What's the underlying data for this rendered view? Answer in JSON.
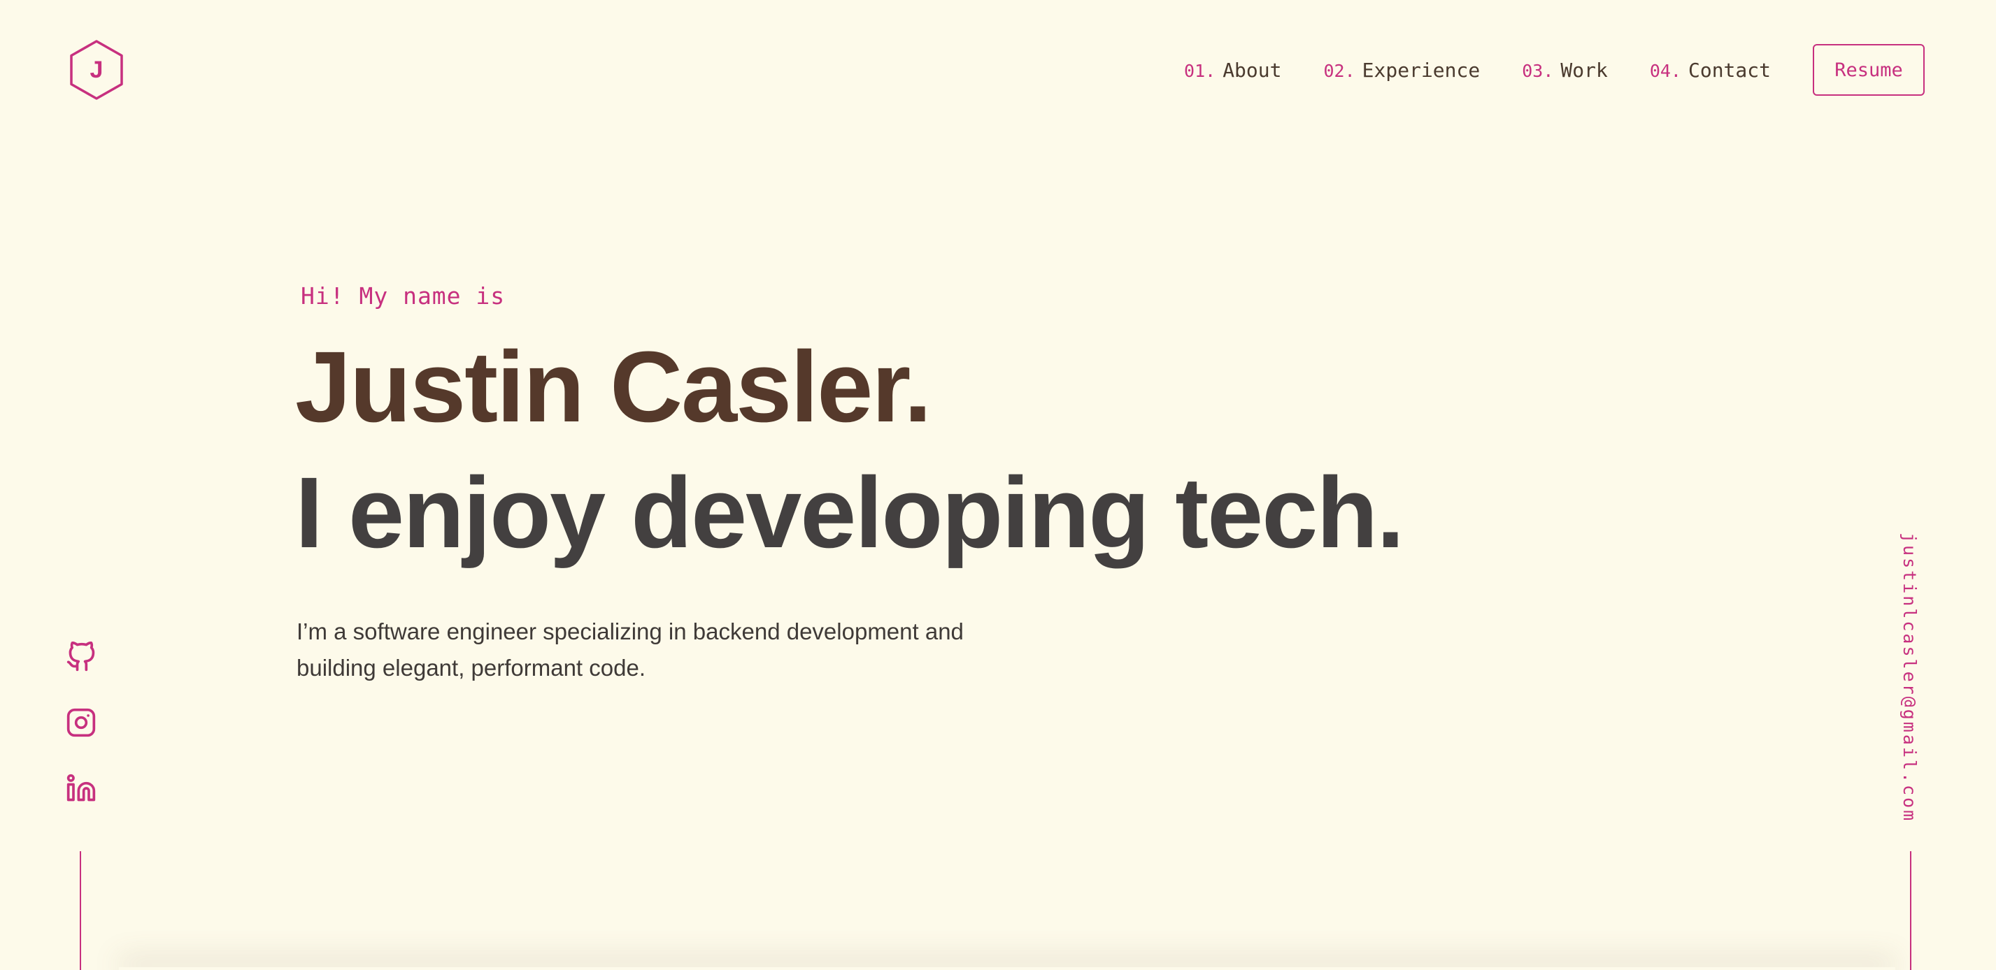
{
  "logo": {
    "letter": "J",
    "icon": "hexagon-logo-icon"
  },
  "nav": {
    "items": [
      {
        "num": "01.",
        "label": "About"
      },
      {
        "num": "02.",
        "label": "Experience"
      },
      {
        "num": "03.",
        "label": "Work"
      },
      {
        "num": "04.",
        "label": "Contact"
      }
    ],
    "resume_label": "Resume"
  },
  "hero": {
    "greeting": "Hi! My name is",
    "name": "Justin Casler.",
    "tagline": "I enjoy developing tech.",
    "description": "I’m a software engineer specializing in backend development and building elegant, performant code."
  },
  "social": {
    "links": [
      {
        "icon": "github-icon"
      },
      {
        "icon": "instagram-icon"
      },
      {
        "icon": "linkedin-icon"
      }
    ]
  },
  "email": "justinlcasler@gmail.com",
  "colors": {
    "background": "#fdfaea",
    "accent": "#c7307f",
    "name": "#55392b",
    "heading": "#434040"
  }
}
